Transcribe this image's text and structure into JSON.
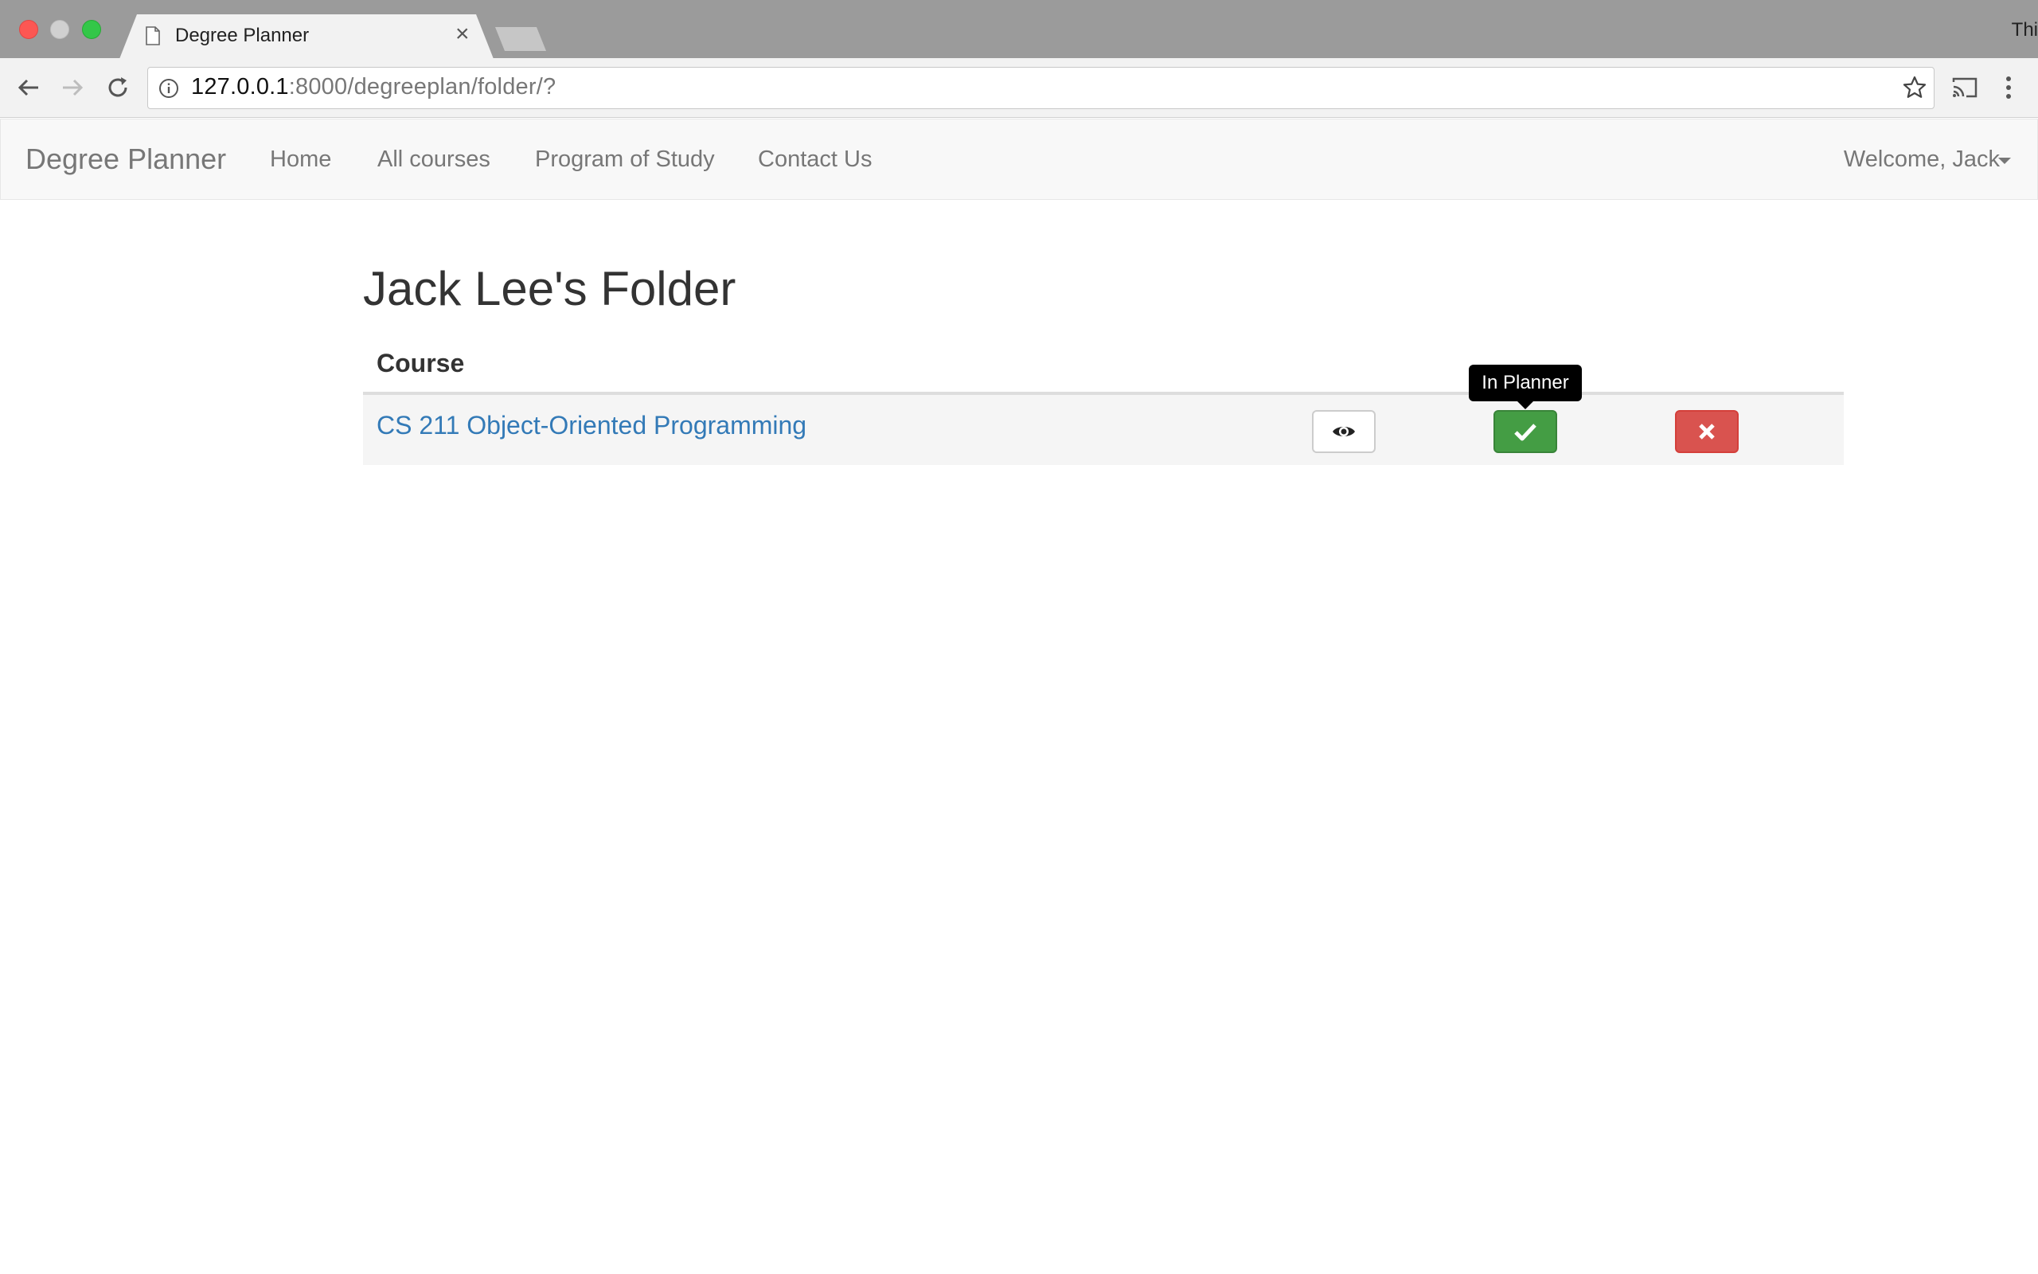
{
  "browser": {
    "tab_title": "Degree Planner",
    "tab_close": "×",
    "profile_label": "Thi",
    "url_host": "127.0.0.1",
    "url_rest": ":8000/degreeplan/folder/?"
  },
  "navbar": {
    "brand": "Degree Planner",
    "links": [
      "Home",
      "All courses",
      "Program of Study",
      "Contact Us"
    ],
    "welcome": "Welcome, Jack"
  },
  "content": {
    "title": "Jack Lee's Folder",
    "table": {
      "header": "Course",
      "rows": [
        {
          "course": "CS 211 Object-Oriented Programming"
        }
      ]
    },
    "tooltip": "In Planner"
  },
  "colors": {
    "link": "#337ab7",
    "success": "#449d44",
    "danger": "#d9534f",
    "navbar_bg": "#f8f8f8"
  },
  "icons": [
    "back-arrow-icon",
    "forward-arrow-icon",
    "reload-icon",
    "info-icon",
    "star-icon",
    "cast-icon",
    "more-vert-icon",
    "eye-icon",
    "check-icon",
    "remove-icon",
    "document-icon"
  ]
}
